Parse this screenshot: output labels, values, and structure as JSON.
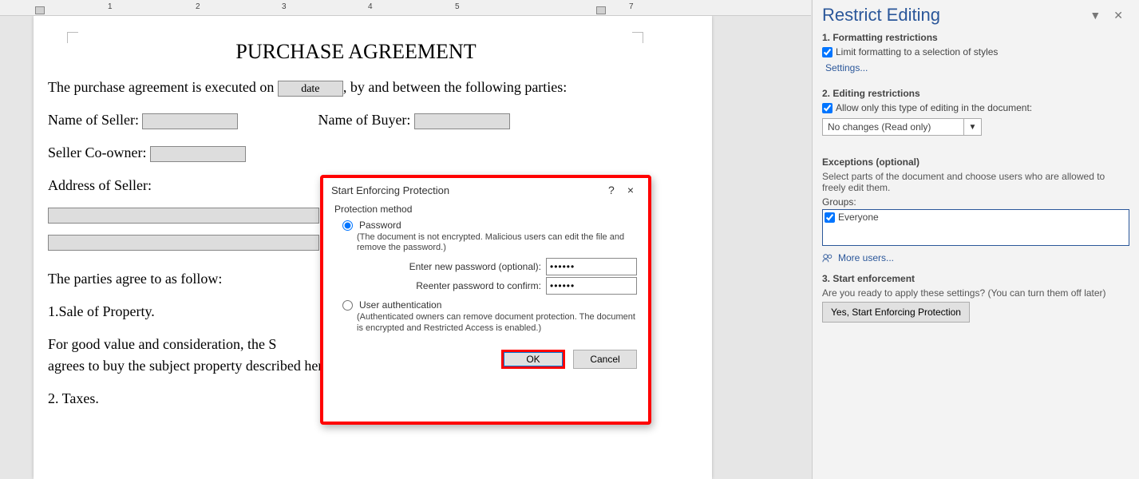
{
  "ruler": {
    "numbers": [
      "1",
      "2",
      "3",
      "4",
      "5",
      "7"
    ]
  },
  "document": {
    "title": "PURCHASE AGREEMENT",
    "para1_prefix": "The purchase agreement is executed on",
    "date_field": "date",
    "para1_suffix": ", by and between the following parties:",
    "name_seller_label": "Name of Seller:",
    "name_buyer_label": "Name of Buyer:",
    "seller_coowner_label": "Seller Co-owner:",
    "address_seller_label": "Address of Seller:",
    "parties_agree": "The parties agree to as follow:",
    "item1": "1.Sale of Property.",
    "good_value": "For good value and consideration, the S",
    "described": "agrees to buy the subject property described herein.",
    "item2": "2. Taxes."
  },
  "dialog": {
    "title": "Start Enforcing Protection",
    "help": "?",
    "close": "×",
    "group": "Protection method",
    "password_radio": "Password",
    "password_desc": "(The document is not encrypted. Malicious users can edit the file and remove the password.)",
    "enter_pwd_label": "Enter new password (optional):",
    "reenter_pwd_label": "Reenter password to confirm:",
    "pwd_value": "••••••",
    "userauth_radio": "User authentication",
    "userauth_desc": "(Authenticated owners can remove document protection. The document is encrypted and Restricted Access is enabled.)",
    "ok": "OK",
    "cancel": "Cancel"
  },
  "panel": {
    "title": "Restrict Editing",
    "dropdown": "▼",
    "close": "✕",
    "sec1_head": "1. Formatting restrictions",
    "sec1_check": "Limit formatting to a selection of styles",
    "settings_link": "Settings...",
    "sec2_head": "2. Editing restrictions",
    "sec2_check": "Allow only this type of editing in the document:",
    "editing_value": "No changes (Read only)",
    "exceptions_head": "Exceptions (optional)",
    "exceptions_desc": "Select parts of the document and choose users who are allowed to freely edit them.",
    "groups_label": "Groups:",
    "everyone": "Everyone",
    "more_users": "More users...",
    "sec3_head": "3. Start enforcement",
    "sec3_desc": "Are you ready to apply these settings? (You can turn them off later)",
    "enforce_btn": "Yes, Start Enforcing Protection"
  }
}
